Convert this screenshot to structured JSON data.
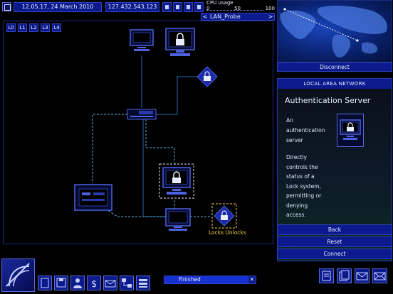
{
  "topbar": {
    "datetime": "12.05.17, 24 March 2010",
    "ip_address": "127.432.543.123",
    "cpu_label": "CPU usage",
    "cpu_scale": [
      "0",
      "50",
      "100"
    ],
    "lan_target": "LAN_Probe",
    "lan_prev": "<",
    "lan_next": ">"
  },
  "levels": [
    "L0",
    "L1",
    "L2",
    "L3",
    "L4"
  ],
  "network": {
    "lock_node_label": "Locks Unlocks",
    "colors": {
      "link_solid": "#2a6ab0",
      "link_dashed": "#5ab0e0",
      "node": "#4d62e0",
      "highlight": "#f0d040"
    }
  },
  "map": {
    "disconnect_label": "Disconnect"
  },
  "info": {
    "header": "LOCAL AREA NETWORK",
    "title": "Authentication Server",
    "desc_lines": [
      "An",
      "authentication",
      "server"
    ],
    "desc2_lines": [
      "Directly",
      "controls the",
      "status of a",
      "Lock system,",
      "permitting or",
      "denying",
      "access."
    ]
  },
  "panel_buttons": {
    "back": "Back",
    "reset": "Reset",
    "connect": "Connect"
  },
  "taskbar": {
    "status": "Finished",
    "close": "✕",
    "tools": [
      "tool-document-icon",
      "tool-save-icon",
      "tool-user-icon",
      "tool-finance-icon",
      "tool-mail-icon",
      "tool-network-icon",
      "tool-database-icon"
    ],
    "right_tools": [
      "notes-icon",
      "files-icon",
      "email-icon",
      "messages-icon"
    ]
  }
}
